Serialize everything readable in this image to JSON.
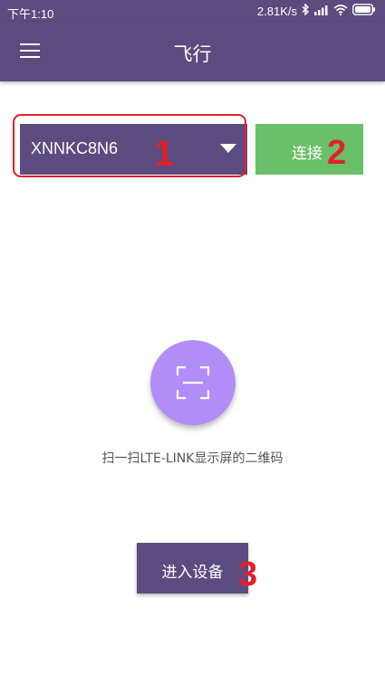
{
  "status_bar": {
    "time": "下午1:10",
    "network_speed": "2.81K/s",
    "icons": [
      "bluetooth-icon",
      "signal-icon",
      "wifi-icon",
      "battery-icon"
    ]
  },
  "app_bar": {
    "title": "飞行",
    "menu_icon": "menu-icon"
  },
  "device_select": {
    "selected_value": "XNNKC8N6",
    "caret_icon": "dropdown-arrow-icon"
  },
  "connect_button": {
    "label": "连接"
  },
  "scan": {
    "icon": "qr-scan-icon",
    "caption": "扫一扫LTE-LINK显示屏的二维码"
  },
  "enter_button": {
    "label": "进入设备"
  },
  "annotations": {
    "one": "1",
    "two": "2",
    "three": "3"
  },
  "colors": {
    "primary": "#5c4b7e",
    "connect": "#6abf69",
    "scan_circle": "#b28df7",
    "annotation": "#e0202a"
  }
}
